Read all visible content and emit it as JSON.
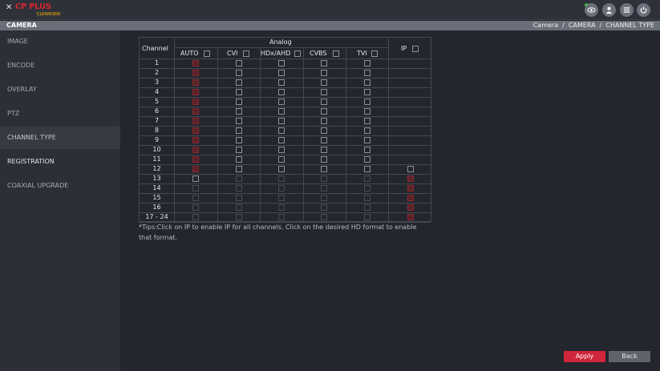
{
  "header": {
    "logo_x": "✕",
    "logo_brand": "CP PLUS",
    "logo_sub": "CLEARVIEW",
    "icons": [
      "eye-icon",
      "user-icon",
      "list-icon",
      "power-icon"
    ]
  },
  "titlebar": {
    "title": "CAMERA",
    "breadcrumb": [
      "Camera",
      "CAMERA",
      "CHANNEL TYPE"
    ],
    "sep": "/"
  },
  "sidebar": {
    "items": [
      {
        "label": "IMAGE"
      },
      {
        "label": "ENCODE"
      },
      {
        "label": "OVERLAY"
      },
      {
        "label": "PTZ"
      },
      {
        "label": "CHANNEL TYPE"
      },
      {
        "label": "REGISTRATION"
      },
      {
        "label": "COAXIAL UPGRADE"
      }
    ]
  },
  "table": {
    "channel_header": "Channel",
    "analog_header": "Analog",
    "columns": [
      "AUTO",
      "CVI",
      "HDx/AHD",
      "CVBS",
      "TVI",
      "IP"
    ],
    "rows": [
      "1",
      "2",
      "3",
      "4",
      "5",
      "6",
      "7",
      "8",
      "9",
      "10",
      "11",
      "12",
      "13",
      "14",
      "15",
      "16",
      "17 - 24"
    ]
  },
  "tips": "*Tips:Click on IP to enable IP for all channels. Click on the desired HD format to enable that format.",
  "buttons": {
    "apply": "Apply",
    "back": "Back"
  },
  "colors": {
    "accent": "#d0253a",
    "background": "#24262e",
    "sidebar": "#2d2f38"
  }
}
